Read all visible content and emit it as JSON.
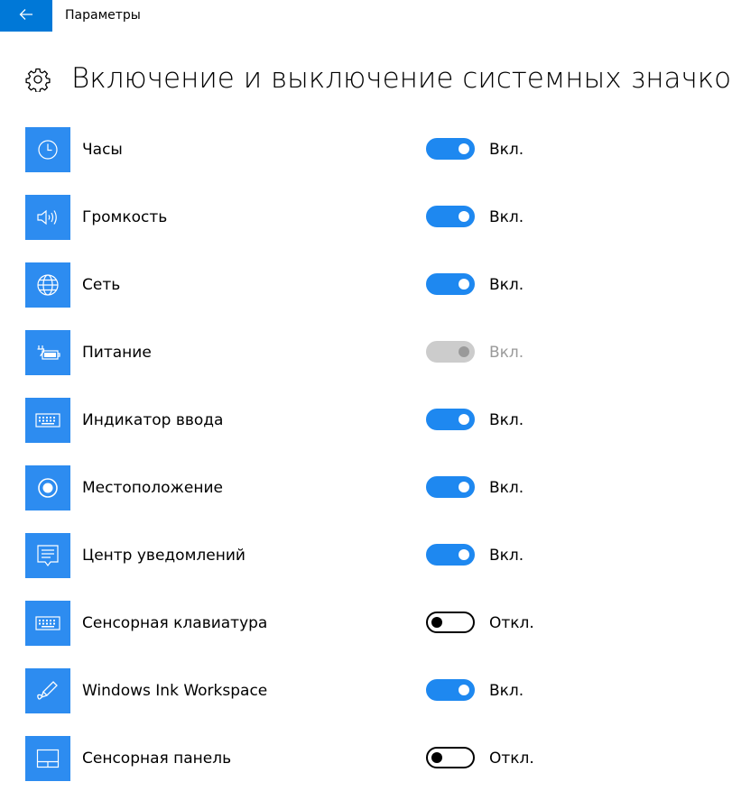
{
  "app": {
    "title": "Параметры",
    "accent_color": "#0078d7"
  },
  "page": {
    "title": "Включение и выключение системных значков",
    "icon": "gear-icon"
  },
  "items": [
    {
      "label": "Часы",
      "icon": "clock-icon",
      "state": "Вкл.",
      "on": true,
      "disabled": false
    },
    {
      "label": "Громкость",
      "icon": "speaker-icon",
      "state": "Вкл.",
      "on": true,
      "disabled": false
    },
    {
      "label": "Сеть",
      "icon": "globe-icon",
      "state": "Вкл.",
      "on": true,
      "disabled": false
    },
    {
      "label": "Питание",
      "icon": "battery-plug-icon",
      "state": "Вкл.",
      "on": true,
      "disabled": true
    },
    {
      "label": "Индикатор ввода",
      "icon": "keyboard-icon",
      "state": "Вкл.",
      "on": true,
      "disabled": false
    },
    {
      "label": "Местоположение",
      "icon": "location-icon",
      "state": "Вкл.",
      "on": true,
      "disabled": false
    },
    {
      "label": "Центр уведомлений",
      "icon": "action-center-icon",
      "state": "Вкл.",
      "on": true,
      "disabled": false
    },
    {
      "label": "Сенсорная клавиатура",
      "icon": "touch-keyboard-icon",
      "state": "Откл.",
      "on": false,
      "disabled": false
    },
    {
      "label": "Windows Ink Workspace",
      "icon": "pen-icon",
      "state": "Вкл.",
      "on": true,
      "disabled": false
    },
    {
      "label": "Сенсорная панель",
      "icon": "touchpad-icon",
      "state": "Откл.",
      "on": false,
      "disabled": false
    }
  ]
}
